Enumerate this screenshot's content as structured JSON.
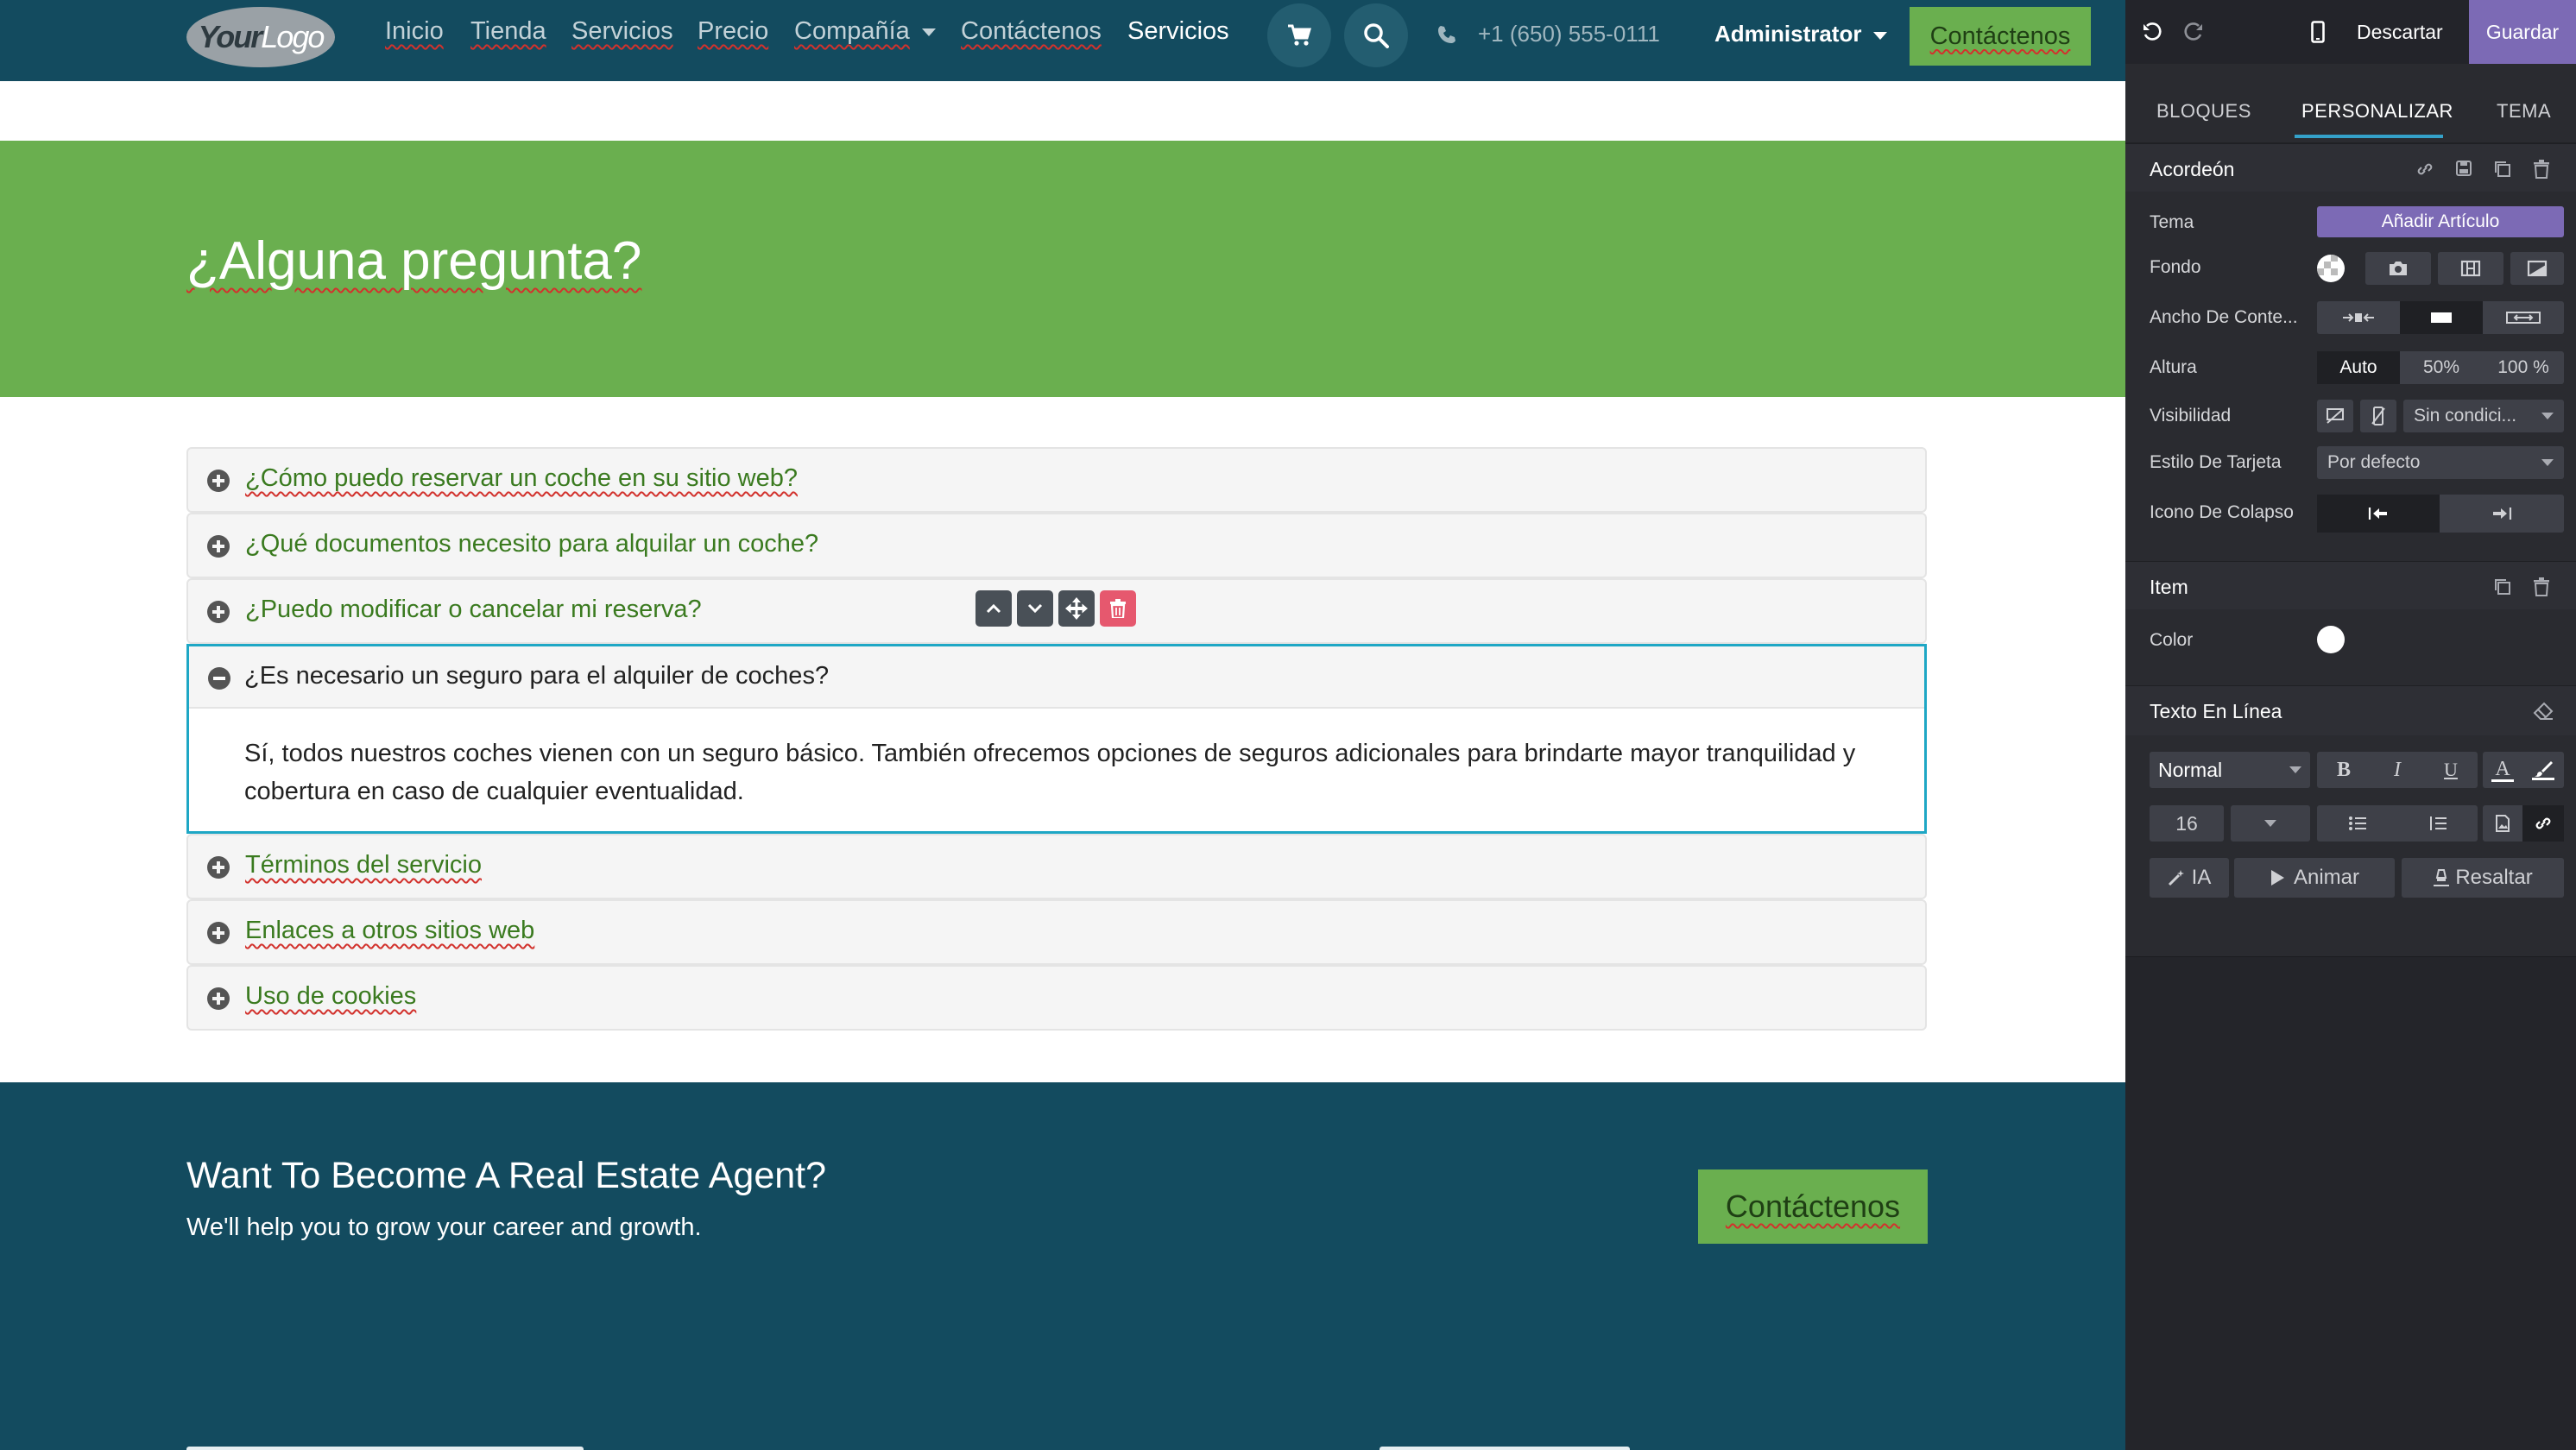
{
  "navbar": {
    "logo_text": "YourLogo",
    "links": [
      "Inicio",
      "Tienda",
      "Servicios",
      "Precio",
      "Compañía",
      "Contáctenos",
      "Servicios"
    ],
    "phone": "+1 (650) 555-0111",
    "user": "Administrator",
    "cta": "Contáctenos"
  },
  "hero": {
    "title": "¿Alguna pregunta?"
  },
  "accordion": {
    "items": [
      "¿Cómo puedo reservar un coche en su sitio web?",
      "¿Qué documentos necesito para alquilar un coche?",
      "¿Puedo modificar o cancelar mi reserva?",
      "¿Es necesario un seguro para el alquiler de coches?",
      "Términos del servicio",
      "Enlaces a otros sitios web",
      "Uso de cookies"
    ],
    "open_answer": "Sí, todos nuestros coches vienen con un seguro básico. También ofrecemos opciones de seguros adicionales para brindarte mayor tranquilidad y cobertura en caso de cualquier eventualidad."
  },
  "footer": {
    "title": "Want To Become A Real Estate Agent?",
    "subtitle": "We'll help you to grow your career and growth.",
    "cta": "Contáctenos"
  },
  "editor": {
    "discard": "Descartar",
    "save": "Guardar",
    "tabs": [
      "BLOQUES",
      "PERSONALIZAR",
      "TEMA"
    ],
    "accordion_section": {
      "title": "Acordeón",
      "tema_label": "Tema",
      "tema_button": "Añadir Artículo",
      "fondo_label": "Fondo",
      "ancho_label": "Ancho De Conte...",
      "altura_label": "Altura",
      "altura_options": [
        "Auto",
        "50%",
        "100 %"
      ],
      "visibilidad_label": "Visibilidad",
      "visibilidad_value": "Sin condici...",
      "estilo_label": "Estilo De Tarjeta",
      "estilo_value": "Por defecto",
      "icono_label": "Icono De Colapso"
    },
    "item_section": {
      "title": "Item",
      "color_label": "Color"
    },
    "text_section": {
      "title": "Texto En Línea",
      "style_value": "Normal",
      "bold": "B",
      "italic": "I",
      "underline": "U",
      "font_color": "A",
      "size_value": "16",
      "ai_button": "IA",
      "animate_button": "Animar",
      "highlight_button": "Resaltar"
    }
  },
  "colors": {
    "navbar_bg": "#134b5f",
    "green": "#6aaf4f",
    "editor_bg": "#2a2b30",
    "save_purple": "#7c6ab5",
    "selection_cyan": "#1ea7c5"
  }
}
